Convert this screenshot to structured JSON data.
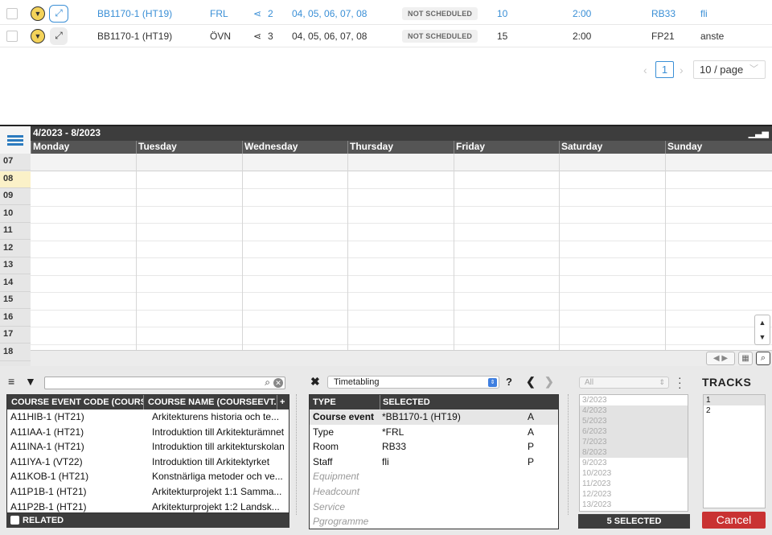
{
  "table_rows": [
    {
      "code": "BB1170-1 (HT19)",
      "type": "FRL",
      "links": "2",
      "weeks": "04, 05, 06, 07, 08",
      "status": "NOT SCHEDULED",
      "count": "10",
      "duration": "2:00",
      "room": "RB33",
      "staff": "fli"
    },
    {
      "code": "BB1170-1 (HT19)",
      "type": "ÖVN",
      "links": "3",
      "weeks": "04, 05, 06, 07, 08",
      "status": "NOT SCHEDULED",
      "count": "15",
      "duration": "2:00",
      "room": "FP21",
      "staff": "anste"
    }
  ],
  "pagination": {
    "page": "1",
    "page_size": "10 / page",
    "prev": "‹",
    "next": "›"
  },
  "calendar": {
    "title": "4/2023 - 8/2023",
    "days": [
      "Monday",
      "Tuesday",
      "Wednesday",
      "Thursday",
      "Friday",
      "Saturday",
      "Sunday"
    ],
    "hours": [
      "07",
      "08",
      "09",
      "10",
      "11",
      "12",
      "13",
      "14",
      "15",
      "16",
      "17",
      "18"
    ]
  },
  "filter": {
    "search_value": ""
  },
  "course_list": {
    "col1": "COURSE EVENT CODE (COURS...",
    "col2": "COURSE NAME (COURSEEVT...",
    "add": "+",
    "rows": [
      {
        "code": "A11HIB-1 (HT21)",
        "name": "Arkitekturens historia och te..."
      },
      {
        "code": "A11IAA-1 (HT21)",
        "name": "Introduktion till Arkitekturämnet"
      },
      {
        "code": "A11INA-1 (HT21)",
        "name": "Introduktion till arkitekturskolan"
      },
      {
        "code": "A11IYA-1 (VT22)",
        "name": "Introduktion till Arkitektyrket"
      },
      {
        "code": "A11KOB-1 (HT21)",
        "name": "Konstnärliga metoder och ve..."
      },
      {
        "code": "A11P1B-1 (HT21)",
        "name": "Arkitekturprojekt 1:1 Samma..."
      },
      {
        "code": "A11P2B-1 (HT21)",
        "name": "Arkitekturprojekt 1:2 Landsk..."
      }
    ],
    "related": "RELATED"
  },
  "selection": {
    "dropdown": "Timetabling",
    "help": "?",
    "col_type": "TYPE",
    "col_selected": "SELECTED",
    "rows": [
      {
        "type": "Course event",
        "value": "*BB1170-1 (HT19)",
        "flag": "A"
      },
      {
        "type": "Type",
        "value": "*FRL",
        "flag": "A"
      },
      {
        "type": "Room",
        "value": "RB33",
        "flag": "P"
      },
      {
        "type": "Staff",
        "value": "fli",
        "flag": "P"
      }
    ],
    "inactive": [
      "Equipment",
      "Headcount",
      "Service",
      "Pgrogramme"
    ]
  },
  "periods": {
    "select": "All",
    "items": [
      "3/2023",
      "4/2023",
      "5/2023",
      "6/2023",
      "7/2023",
      "8/2023",
      "9/2023",
      "10/2023",
      "11/2023",
      "12/2023",
      "13/2023"
    ],
    "selected_count": "5 SELECTED"
  },
  "tracks": {
    "title": "TRACKS",
    "items": [
      "1",
      "2"
    ],
    "cancel": "Cancel"
  }
}
